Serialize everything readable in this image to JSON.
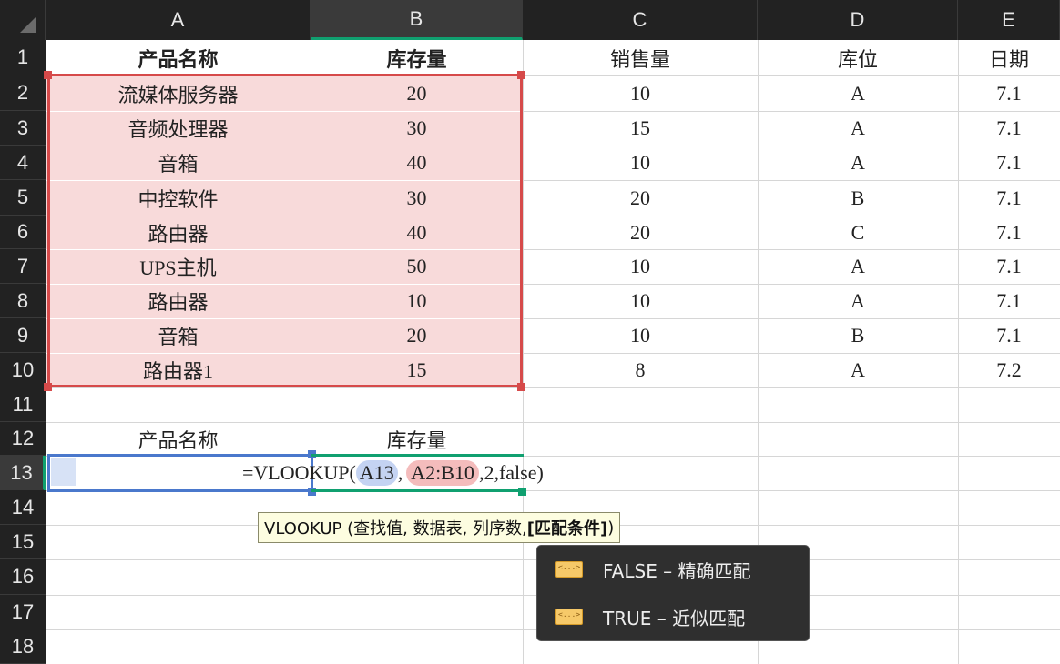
{
  "columns": [
    "A",
    "B",
    "C",
    "D",
    "E"
  ],
  "rows": [
    "1",
    "2",
    "3",
    "4",
    "5",
    "6",
    "7",
    "8",
    "9",
    "10",
    "11",
    "12",
    "13",
    "14",
    "15",
    "16",
    "17",
    "18"
  ],
  "header": [
    "产品名称",
    "库存量",
    "销售量",
    "库位",
    "日期"
  ],
  "table": [
    [
      "流媒体服务器",
      "20",
      "10",
      "A",
      "7.1"
    ],
    [
      "音频处理器",
      "30",
      "15",
      "A",
      "7.1"
    ],
    [
      "音箱",
      "40",
      "10",
      "A",
      "7.1"
    ],
    [
      "中控软件",
      "30",
      "20",
      "B",
      "7.1"
    ],
    [
      "路由器",
      "40",
      "20",
      "C",
      "7.1"
    ],
    [
      "UPS主机",
      "50",
      "10",
      "A",
      "7.1"
    ],
    [
      "路由器",
      "10",
      "10",
      "A",
      "7.1"
    ],
    [
      "音箱",
      "20",
      "10",
      "B",
      "7.1"
    ],
    [
      "路由器1",
      "15",
      "8",
      "A",
      "7.2"
    ]
  ],
  "lookup": {
    "label_a": "产品名称",
    "label_b": "库存量",
    "formula_prefix": "=VLOOKUP(",
    "arg1": "A13",
    "sep1": ",",
    "arg2": "A2:B10",
    "rest": ",2,false)"
  },
  "tooltip": {
    "prefix": "VLOOKUP (查找值, 数据表, 列序数, ",
    "current_arg": "[匹配条件]",
    "suffix": ")"
  },
  "autocomplete": {
    "options": [
      {
        "label": "FALSE – 精确匹配",
        "icon": "enum-value-icon"
      },
      {
        "label": "TRUE – 近似匹配",
        "icon": "enum-value-icon"
      }
    ]
  },
  "colors": {
    "range_ref": "#d64a4a",
    "arg_ref": "#4a78cc",
    "active_cell": "#10a070",
    "range_fill": "#f8dada"
  }
}
